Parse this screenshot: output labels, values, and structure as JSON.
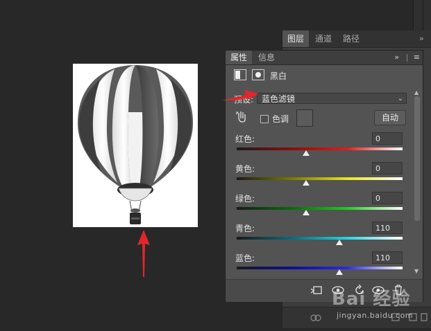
{
  "layers_panel": {
    "tabs": [
      "图层",
      "通道",
      "路径"
    ],
    "menu_glyph": "»"
  },
  "edge": {
    "percent_1": "%",
    "percent_2": "%"
  },
  "properties": {
    "tabs": [
      "属性",
      "信息"
    ],
    "collapse_glyph": "»",
    "menu_glyph": "≡",
    "adjustment_name": "黑白",
    "preset_label": "预设:",
    "preset_value": "蓝色滤镜",
    "tint_label": "色调",
    "auto_button": "自动",
    "sliders": [
      {
        "label": "红色:",
        "value": "0",
        "gradient": [
          "#1a1a1a",
          "#8b0d0d",
          "#e01c1c",
          "#ffffff"
        ],
        "position": 0.42
      },
      {
        "label": "黄色:",
        "value": "0",
        "gradient": [
          "#1a1a1a",
          "#7a7a00",
          "#e6e61c",
          "#ffffff"
        ],
        "position": 0.42
      },
      {
        "label": "绿色:",
        "value": "0",
        "gradient": [
          "#1a1a1a",
          "#0a6b0a",
          "#1fcc1f",
          "#ffffff"
        ],
        "position": 0.42
      },
      {
        "label": "青色:",
        "value": "110",
        "gradient": [
          "#1a1a1a",
          "#0b6a7a",
          "#22d6e6",
          "#ffffff"
        ],
        "position": 0.62
      },
      {
        "label": "蓝色:",
        "value": "110",
        "gradient": [
          "#1a1a1a",
          "#0d0d9a",
          "#2a2ae6",
          "#ffffff"
        ],
        "position": 0.62
      }
    ]
  },
  "watermark": {
    "brand": "Bai 经验",
    "url": "jingyan.baidu.com"
  },
  "colors": {
    "arrow": "#e2262b",
    "panel_bg": "#535353",
    "workspace_bg": "#282828"
  }
}
